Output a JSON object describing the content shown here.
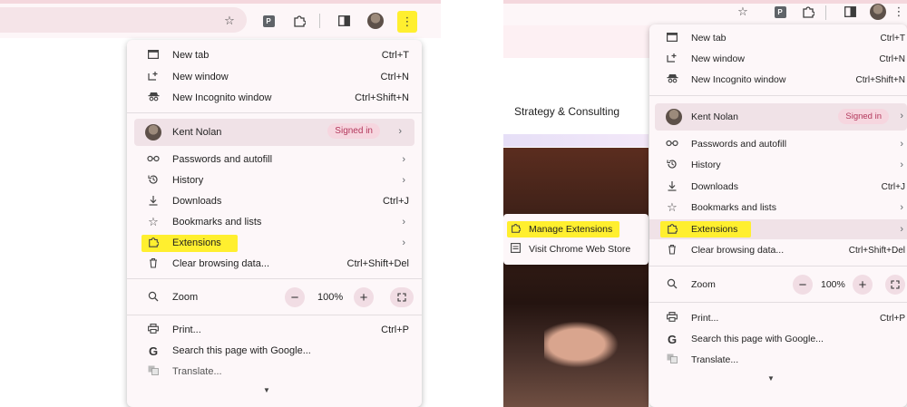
{
  "toolbar": {
    "left_profile_tag": "P",
    "right_profile_tag": "P"
  },
  "menu": {
    "new_tab": {
      "label": "New tab",
      "shortcut": "Ctrl+T"
    },
    "new_window": {
      "label": "New window",
      "shortcut": "Ctrl+N"
    },
    "new_incognito": {
      "label": "New Incognito window",
      "shortcut": "Ctrl+Shift+N"
    },
    "profile": {
      "name": "Kent Nolan",
      "status": "Signed in"
    },
    "passwords": {
      "label": "Passwords and autofill"
    },
    "history": {
      "label": "History"
    },
    "downloads": {
      "label": "Downloads",
      "shortcut": "Ctrl+J"
    },
    "bookmarks": {
      "label": "Bookmarks and lists"
    },
    "extensions": {
      "label": "Extensions"
    },
    "clear_browsing": {
      "label": "Clear browsing data...",
      "shortcut": "Ctrl+Shift+Del"
    },
    "zoom": {
      "label": "Zoom",
      "minus": "−",
      "value": "100%",
      "plus": "+"
    },
    "print": {
      "label": "Print...",
      "shortcut": "Ctrl+P"
    },
    "search_page": {
      "label": "Search this page with Google..."
    },
    "translate": {
      "label": "Translate..."
    }
  },
  "page": {
    "heading": "Strategy & Consulting"
  },
  "submenu": {
    "manage_extensions": "Manage Extensions",
    "web_store": "Visit Chrome Web Store"
  },
  "icons": {
    "star": "☆",
    "kebab": "⋮",
    "chevron": "›",
    "fullscreen": "⛶"
  },
  "colors": {
    "highlight": "#ffef2f",
    "menu_bg": "#fdf7f9",
    "signed_in_pill": "#f6d6df",
    "signed_in_text": "#b3385c"
  }
}
